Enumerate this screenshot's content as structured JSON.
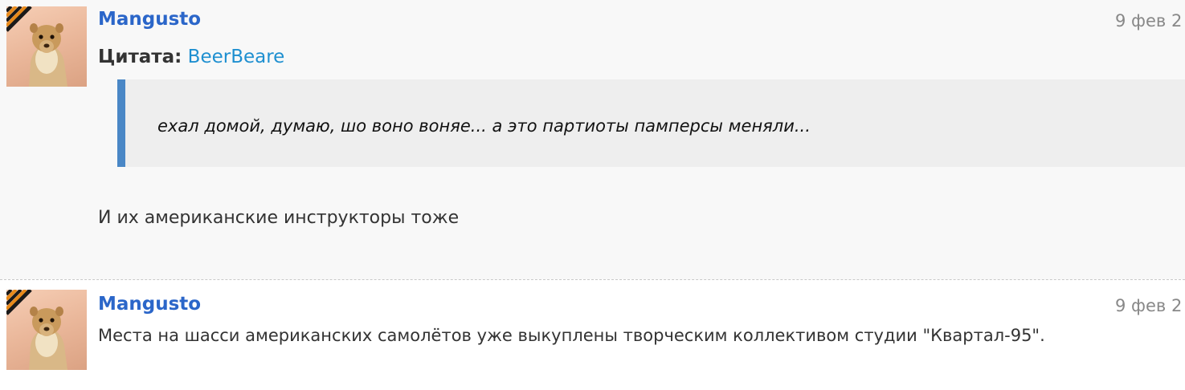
{
  "posts": [
    {
      "author": "Mangusto",
      "date": "9 фев 2",
      "quote": {
        "label": "Цитата:",
        "author": "BeerBeare",
        "text": "ехал домой, думаю, шо воно воняе... а это партиоты памперсы меняли..."
      },
      "text": "И их американские инструкторы тоже"
    },
    {
      "author": "Mangusto",
      "date": "9 фев 2",
      "text": "Места на шасси американских самолётов уже выкуплены творческим коллективом студии \"Квартал-95\"."
    }
  ],
  "colors": {
    "author_link": "#2b66c9",
    "quote_link": "#1e8fd0",
    "quote_bar": "#4a87c6",
    "quote_bg": "#eeeeee",
    "post_bg_alt": "#f8f8f8",
    "ribbon_black": "#1a1a1a",
    "ribbon_orange": "#e88a1a"
  }
}
